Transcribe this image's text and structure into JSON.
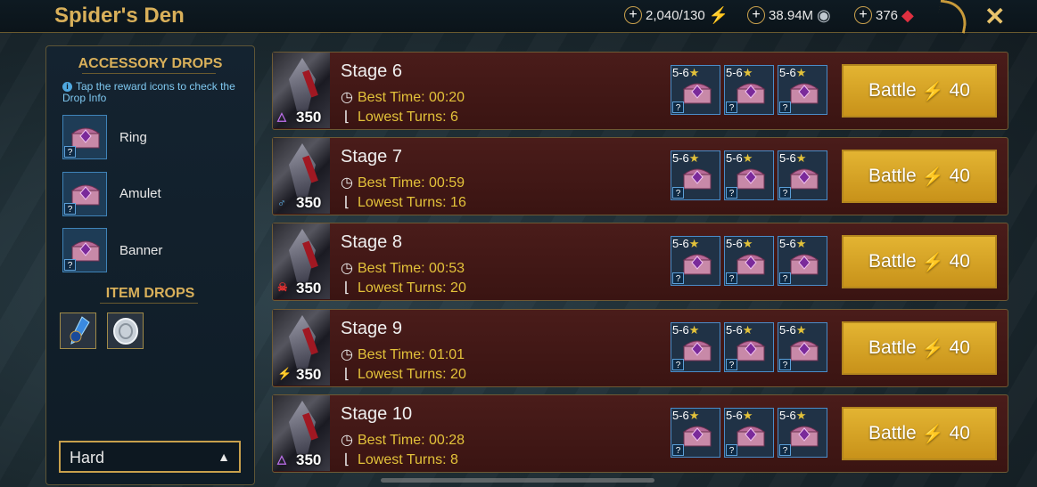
{
  "header": {
    "title": "Spider's Den",
    "energy": "2,040/130",
    "silver": "38.94M",
    "gems": "376",
    "close_icon": "close-icon"
  },
  "sidebar": {
    "accessory_heading": "ACCESSORY DROPS",
    "hint": "Tap the reward icons to check the Drop Info",
    "accessories": [
      {
        "label": "Ring"
      },
      {
        "label": "Amulet"
      },
      {
        "label": "Banner"
      }
    ],
    "item_heading": "ITEM DROPS",
    "item_icons": [
      "potion-icon",
      "silver-coin-icon"
    ],
    "difficulty": "Hard"
  },
  "stages": [
    {
      "name": "Stage 6",
      "level": "350",
      "affinity": "magic-icon",
      "best_time": "Best Time: 00:20",
      "lowest_turns": "Lowest Turns: 6",
      "battle": "Battle",
      "cost": "40"
    },
    {
      "name": "Stage 7",
      "level": "350",
      "affinity": "spirit-icon",
      "best_time": "Best Time: 00:59",
      "lowest_turns": "Lowest Turns: 16",
      "battle": "Battle",
      "cost": "40"
    },
    {
      "name": "Stage 8",
      "level": "350",
      "affinity": "force-icon",
      "best_time": "Best Time: 00:53",
      "lowest_turns": "Lowest Turns: 20",
      "battle": "Battle",
      "cost": "40"
    },
    {
      "name": "Stage 9",
      "level": "350",
      "affinity": "void-icon",
      "best_time": "Best Time: 01:01",
      "lowest_turns": "Lowest Turns: 20",
      "battle": "Battle",
      "cost": "40"
    },
    {
      "name": "Stage 10",
      "level": "350",
      "affinity": "magic-icon",
      "best_time": "Best Time: 00:28",
      "lowest_turns": "Lowest Turns: 8",
      "battle": "Battle",
      "cost": "40"
    }
  ],
  "reward": {
    "range": "5-6",
    "star": "★",
    "unknown": "?"
  },
  "colors": {
    "gold": "#d9b05a",
    "stat": "#e3c23a",
    "battle": "#e3b432"
  }
}
